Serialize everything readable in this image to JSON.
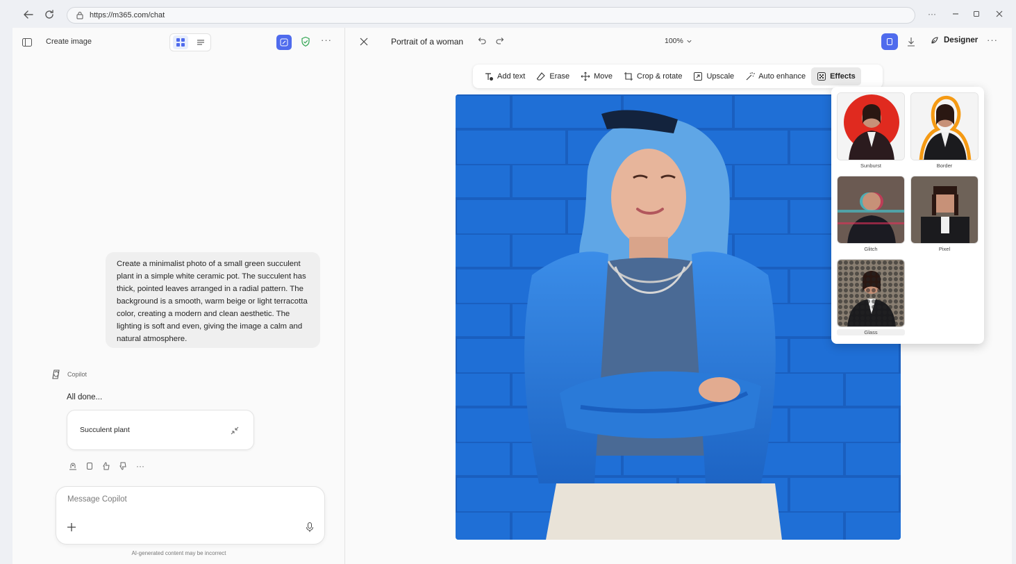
{
  "browser": {
    "url": "https://m365.com/chat"
  },
  "left_panel": {
    "title": "Create image",
    "prompt": "Create a minimalist photo of a small green succulent plant in a simple white ceramic pot. The succulent has thick, pointed leaves arranged in a radial pattern. The background is a smooth, warm beige or light terracotta color, creating a modern and clean aesthetic. The lighting is soft and even, giving the image a calm and natural atmosphere.",
    "assistant_name": "Copilot",
    "response_text": "All done...",
    "card_title": "Succulent plant",
    "composer_placeholder": "Message Copilot",
    "disclaimer": "AI-generated content may be incorrect",
    "more": "···"
  },
  "editor": {
    "title": "Portrait of a woman",
    "zoom": "100%",
    "designer_label": "Designer",
    "more": "···",
    "toolbar": [
      {
        "label": "Add text",
        "icon": "add-text-icon"
      },
      {
        "label": "Erase",
        "icon": "eraser-icon"
      },
      {
        "label": "Move",
        "icon": "move-icon"
      },
      {
        "label": "Crop & rotate",
        "icon": "crop-icon"
      },
      {
        "label": "Upscale",
        "icon": "upscale-icon"
      },
      {
        "label": "Auto enhance",
        "icon": "magic-wand-icon"
      },
      {
        "label": "Effects",
        "icon": "effects-icon",
        "active": true
      }
    ],
    "effects": [
      {
        "label": "Sunburst"
      },
      {
        "label": "Border"
      },
      {
        "label": "Glitch"
      },
      {
        "label": "Pixel"
      },
      {
        "label": "Glass",
        "selected": true
      }
    ]
  },
  "colors": {
    "accent": "#4f6bed",
    "photo_background": "#1f6fd6",
    "shield": "#2ea44f"
  }
}
